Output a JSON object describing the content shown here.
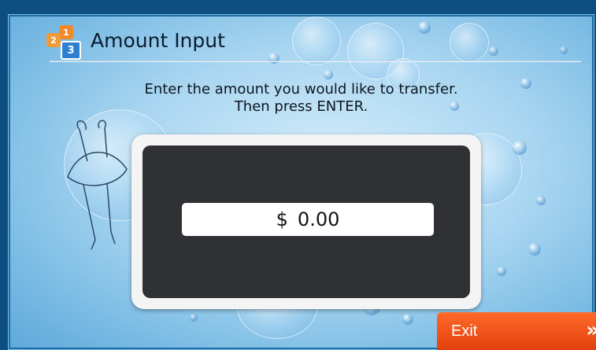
{
  "screen": {
    "title": "Amount Input",
    "step_icons": [
      "1",
      "2",
      "3"
    ],
    "instruction_line1": "Enter the amount you would like to transfer.",
    "instruction_line2": "Then press ENTER.",
    "amount": {
      "currency_symbol": "$",
      "value": "0.00"
    },
    "exit_button": {
      "label": "Exit",
      "chevron": "»"
    }
  },
  "colors": {
    "exit_button": "#e8501a",
    "panel_background": "#a9d6f1",
    "input_frame": "#303134"
  },
  "icons": [
    "step-indicator-icon",
    "chevron-right-icon"
  ]
}
